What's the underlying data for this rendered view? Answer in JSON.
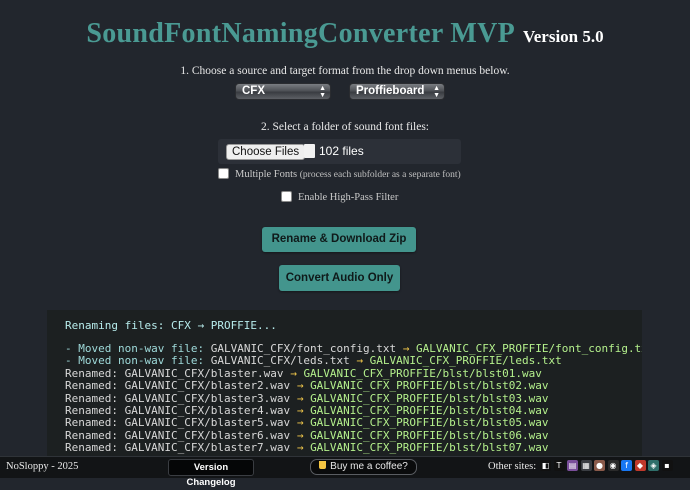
{
  "header": {
    "title": "SoundFontNamingConverter MVP",
    "version": "Version 5.0"
  },
  "step1": {
    "instruction": "1. Choose a source and target format from the drop down menus below.",
    "source_value": "CFX",
    "target_value": "Proffieboard"
  },
  "step2": {
    "instruction": "2. Select a folder of sound font files:",
    "choose_label": "Choose Files",
    "file_count": "102 files"
  },
  "options": {
    "multiple_fonts_label": "Multiple Fonts",
    "multiple_fonts_note": "(process each subfolder as a separate font)",
    "multiple_fonts_checked": false,
    "highpass_label": "Enable High-Pass Filter",
    "highpass_checked": false
  },
  "actions": {
    "rename_label": "Rename & Download Zip",
    "convert_label": "Convert Audio Only"
  },
  "console": {
    "header": "Renaming files: CFX → PROFFIE...",
    "moved": [
      {
        "prefix": "- Moved non-wav file:",
        "src": "GALVANIC_CFX/font_config.txt",
        "dest": "GALVANIC_CFX_PROFFIE/font_config.txt"
      },
      {
        "prefix": "- Moved non-wav file:",
        "src": "GALVANIC_CFX/leds.txt",
        "dest": "GALVANIC_CFX_PROFFIE/leds.txt"
      }
    ],
    "renamed_prefix": "Renamed:",
    "arrow": "→",
    "renamed": [
      {
        "src": "GALVANIC_CFX/blaster.wav",
        "dest": "GALVANIC_CFX_PROFFIE/blst/blst01.wav"
      },
      {
        "src": "GALVANIC_CFX/blaster2.wav",
        "dest": "GALVANIC_CFX_PROFFIE/blst/blst02.wav"
      },
      {
        "src": "GALVANIC_CFX/blaster3.wav",
        "dest": "GALVANIC_CFX_PROFFIE/blst/blst03.wav"
      },
      {
        "src": "GALVANIC_CFX/blaster4.wav",
        "dest": "GALVANIC_CFX_PROFFIE/blst/blst04.wav"
      },
      {
        "src": "GALVANIC_CFX/blaster5.wav",
        "dest": "GALVANIC_CFX_PROFFIE/blst/blst05.wav"
      },
      {
        "src": "GALVANIC_CFX/blaster6.wav",
        "dest": "GALVANIC_CFX_PROFFIE/blst/blst06.wav"
      },
      {
        "src": "GALVANIC_CFX/blaster7.wav",
        "dest": "GALVANIC_CFX_PROFFIE/blst/blst07.wav"
      }
    ]
  },
  "footer": {
    "copyright": "NoSloppy - 2025",
    "changelog_label": "Version Changelog",
    "coffee_label": "Buy me a coffee?",
    "other_sites_label": "Other sites:",
    "site_icons": [
      {
        "name": "site-icon-1",
        "glyph": "◧",
        "color": "#111111"
      },
      {
        "name": "site-icon-2",
        "glyph": "T",
        "color": "#111111"
      },
      {
        "name": "site-icon-3",
        "glyph": "▤",
        "color": "#7a4e9a"
      },
      {
        "name": "site-icon-4",
        "glyph": "▦",
        "color": "#3a3d42"
      },
      {
        "name": "site-icon-5",
        "glyph": "●",
        "color": "#8a5a4a"
      },
      {
        "name": "site-icon-6",
        "glyph": "◉",
        "color": "#2a2a2a"
      },
      {
        "name": "site-icon-7",
        "glyph": "f",
        "color": "#1877f2"
      },
      {
        "name": "site-icon-8",
        "glyph": "◆",
        "color": "#c0392b"
      },
      {
        "name": "site-icon-9",
        "glyph": "◈",
        "color": "#2f6f6a"
      },
      {
        "name": "site-icon-10",
        "glyph": "▪",
        "color": "#111111"
      }
    ]
  }
}
